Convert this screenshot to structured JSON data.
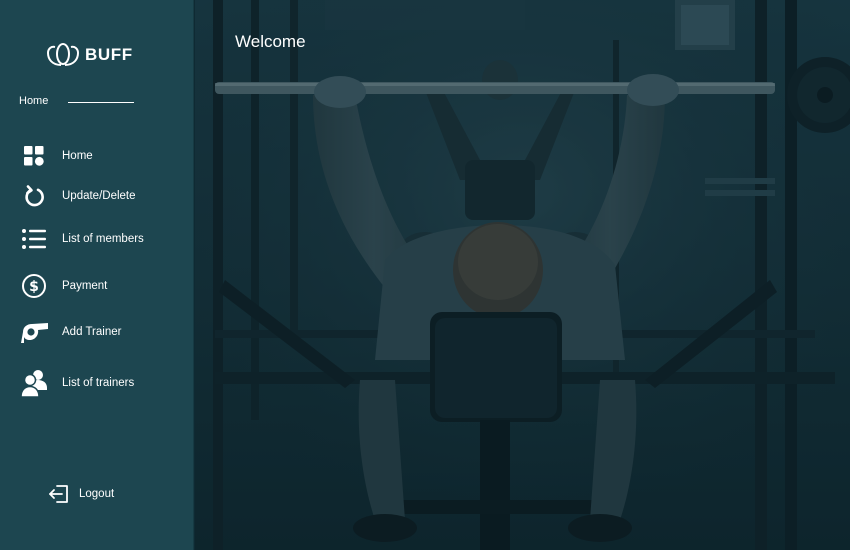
{
  "brand": {
    "name": "BUFF",
    "logo_icon": "lotus-logo-icon"
  },
  "sidebar": {
    "section_label": "Home",
    "items": [
      {
        "label": "Home",
        "icon": "dashboard-icon"
      },
      {
        "label": "Update/Delete",
        "icon": "refresh-icon"
      },
      {
        "label": "List of members",
        "icon": "list-icon"
      },
      {
        "label": "Payment",
        "icon": "dollar-icon"
      },
      {
        "label": "Add Trainer",
        "icon": "whistle-icon"
      },
      {
        "label": "List of trainers",
        "icon": "users-icon"
      }
    ],
    "logout_label": "Logout"
  },
  "main": {
    "heading": "Welcome",
    "background": "gym-bench-press-photo"
  },
  "colors": {
    "sidebar": "#1d4650",
    "overlay": "#0f2a33",
    "text": "#ffffff"
  }
}
